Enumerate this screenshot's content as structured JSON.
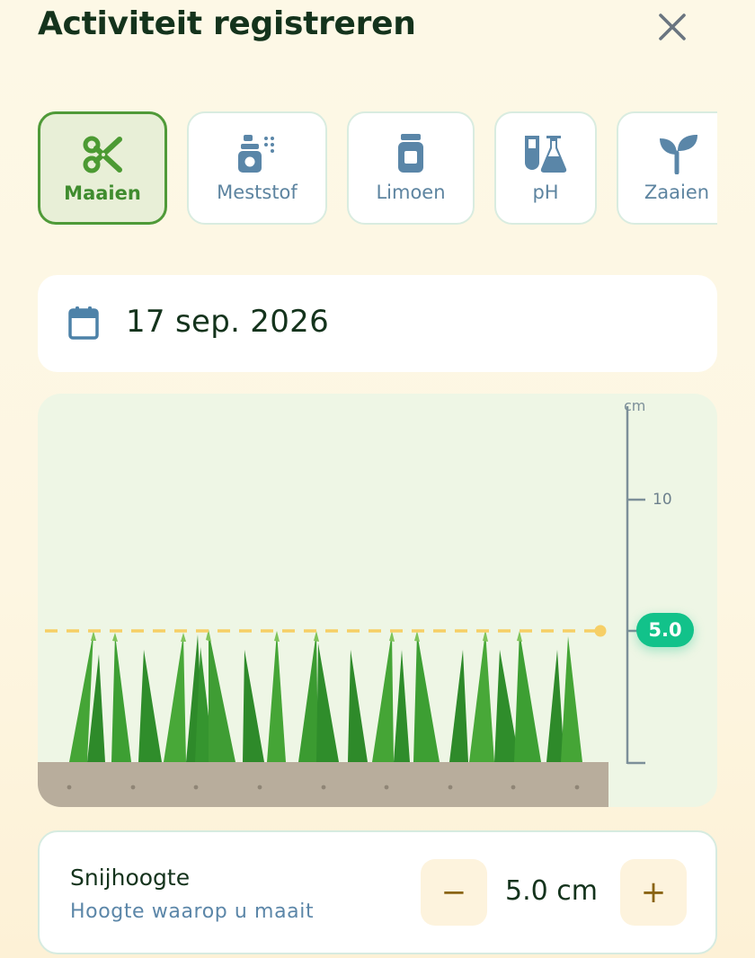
{
  "header": {
    "title": "Activiteit registreren",
    "close_icon": "close-icon"
  },
  "activities": [
    {
      "label": "Maaien",
      "icon": "scissors-icon",
      "selected": true
    },
    {
      "label": "Meststof",
      "icon": "spray-bottle-icon",
      "selected": false
    },
    {
      "label": "Limoen",
      "icon": "jar-icon",
      "selected": false
    },
    {
      "label": "pH",
      "icon": "test-tubes-icon",
      "selected": false
    },
    {
      "label": "Zaaien",
      "icon": "sprout-icon",
      "selected": false
    }
  ],
  "date": {
    "icon": "calendar-icon",
    "value": "17 sep. 2026"
  },
  "height_visual": {
    "unit": "cm",
    "tick_label": "10",
    "current_height": "5.0"
  },
  "cutting_height": {
    "title": "Snijhoogte",
    "subtitle": "Hoogte waarop u maait",
    "value": "5.0 cm",
    "decrease_label": "−",
    "increase_label": "+"
  },
  "colors": {
    "accent_green": "#4f9a38",
    "badge_green": "#12c28a",
    "guide_yellow": "#f6cf66",
    "soil": "#b8ad9c"
  }
}
